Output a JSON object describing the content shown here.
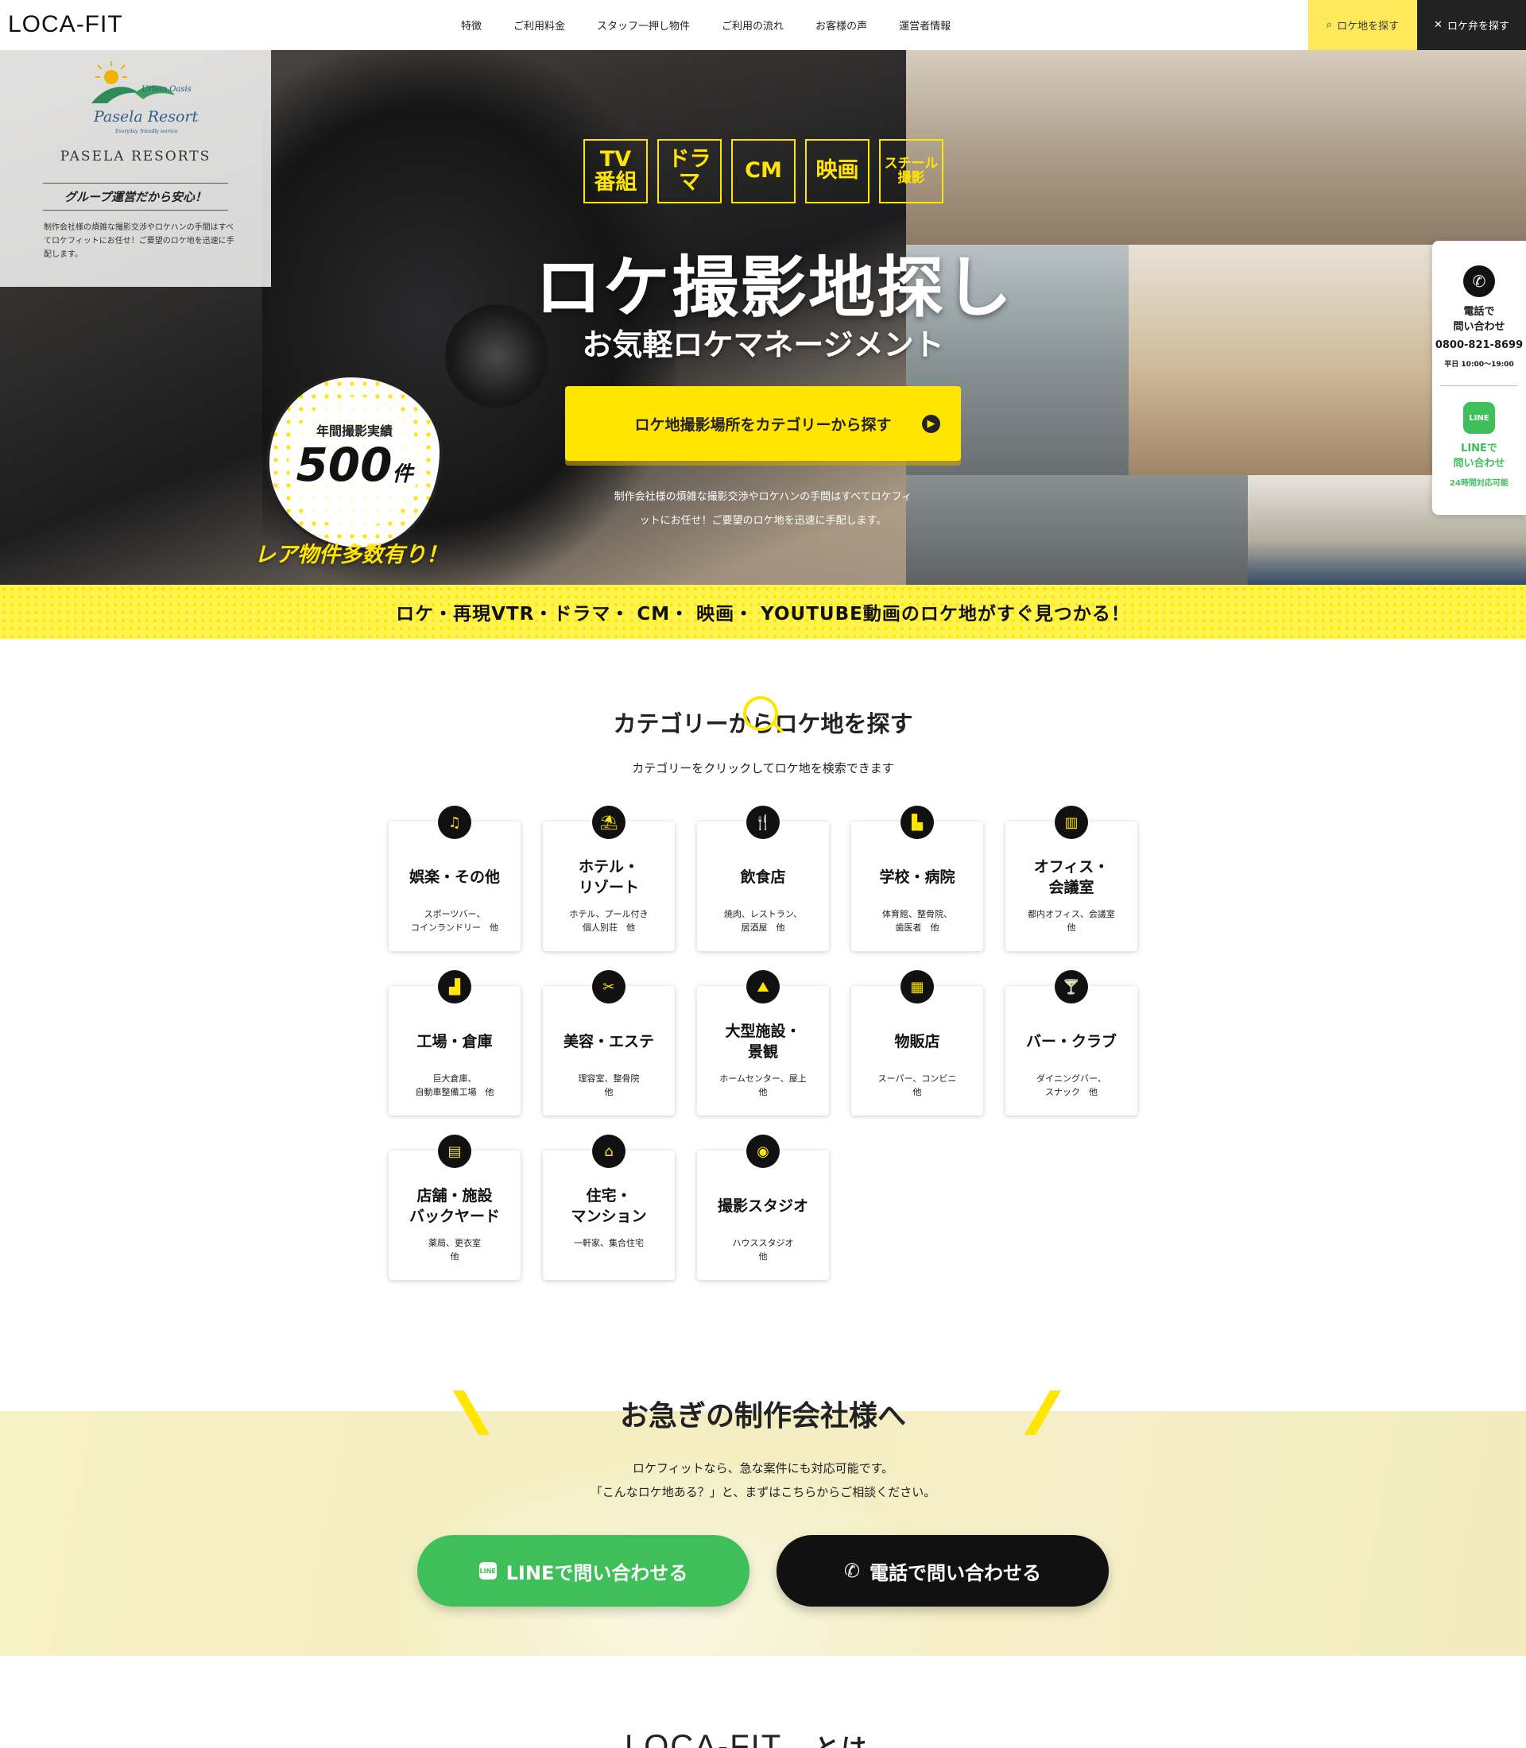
{
  "header": {
    "logo": "LOCA-FIT",
    "nav": [
      "特徴",
      "ご利用料金",
      "スタッフ一押し物件",
      "ご利用の流れ",
      "お客様の声",
      "運営者情報"
    ],
    "search_button": "ロケ地を探す",
    "bento_button": "ロケ弁を探す"
  },
  "pasela": {
    "name": "PASELA RESORTS",
    "emblem_text": "Urban Oasis / Pasela Resorts / Everyday, friendly service",
    "catch": "グループ運営だから安心！",
    "desc": "制作会社様の煩雑な撮影交渉やロケハンの手間はすべてロケフィットにお任せ！ご要望のロケ地を迅速に手配します。"
  },
  "hero": {
    "tags": [
      "TV\n番組",
      "ドラマ",
      "CM",
      "映画",
      "スチール\n撮影"
    ],
    "title": "ロケ撮影地探し",
    "subtitle": "お気軽ロケマネージメント",
    "cta": "ロケ地撮影場所をカテゴリーから探す",
    "desc": "制作会社様の煩雑な撮影交渉やロケハンの手間はすべてロケフィットにお任せ！ご要望のロケ地を迅速に手配します。",
    "bubble_label": "年間撮影実績",
    "bubble_num": "500",
    "bubble_unit": "件",
    "rare": "レア物件多数有り！"
  },
  "band": "ロケ・再現VTR・ドラマ・ CM・ 映画・ YOUTUBE動画のロケ地がすぐ見つかる！",
  "side": {
    "tel_label": "電話で\n問い合わせ",
    "tel_number": "0800-821-8699",
    "tel_hours": "平日 10:00〜19:00",
    "line_icon": "LINE",
    "line_label": "LINEで\n問い合わせ",
    "line_hours": "24時間対応可能"
  },
  "category": {
    "title": "カテゴリーからロケ地を探す",
    "subtitle": "カテゴリーをクリックしてロケ地を検索できます",
    "items": [
      {
        "icon": "music-icon",
        "glyph": "♫",
        "name": "娯楽・その他",
        "examples": "スポーツバー、\nコインランドリー　他"
      },
      {
        "icon": "umbrella-icon",
        "glyph": "⛱",
        "name": "ホテル・\nリゾート",
        "examples": "ホテル、プール付き\n個人別荘　他"
      },
      {
        "icon": "utensils-icon",
        "glyph": "🍴",
        "name": "飲食店",
        "examples": "焼肉、レストラン、\n居酒屋　他"
      },
      {
        "icon": "school-icon",
        "glyph": "▙",
        "name": "学校・病院",
        "examples": "体育館、整骨院、\n歯医者　他"
      },
      {
        "icon": "building-icon",
        "glyph": "▥",
        "name": "オフィス・\n会議室",
        "examples": "都内オフィス、会議室\n他"
      },
      {
        "icon": "factory-icon",
        "glyph": "▟",
        "name": "工場・倉庫",
        "examples": "巨大倉庫、\n自動車整備工場　他"
      },
      {
        "icon": "scissors-icon",
        "glyph": "✂",
        "name": "美容・エステ",
        "examples": "理容室、整骨院\n他"
      },
      {
        "icon": "landmark-icon",
        "glyph": "⛰",
        "name": "大型施設・\n景観",
        "examples": "ホームセンター、屋上\n他"
      },
      {
        "icon": "store-icon",
        "glyph": "▦",
        "name": "物販店",
        "examples": "スーパー、コンビニ\n他"
      },
      {
        "icon": "cocktail-icon",
        "glyph": "🍸",
        "name": "バー・クラブ",
        "examples": "ダイニングバー、\nスナック　他"
      },
      {
        "icon": "shop-icon",
        "glyph": "▤",
        "name": "店舗・施設\nバックヤード",
        "examples": "薬局、更衣室\n他"
      },
      {
        "icon": "home-icon",
        "glyph": "⌂",
        "name": "住宅・\nマンション",
        "examples": "一軒家、集合住宅"
      },
      {
        "icon": "camera-icon",
        "glyph": "◉",
        "name": "撮影スタジオ",
        "examples": "ハウススタジオ\n他"
      }
    ]
  },
  "urgent": {
    "title": "お急ぎの制作会社様へ",
    "p1": "ロケフィットなら、急な案件にも対応可能です。",
    "p2": "「こんなロケ地ある？」と、まずはこちらからご相談ください。",
    "line_icon": "LINE",
    "line_button": "LINEで問い合わせる",
    "tel_button": "電話で問い合わせる"
  },
  "about": {
    "logo": "LOCA-FIT",
    "suffix": "とは"
  }
}
